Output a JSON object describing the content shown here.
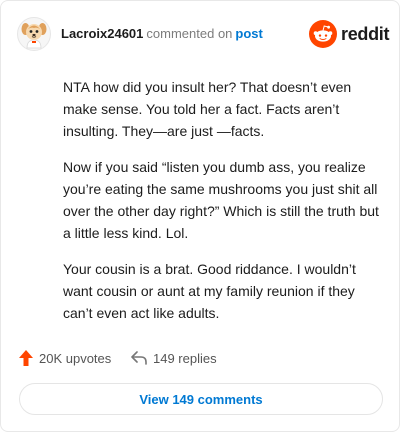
{
  "header": {
    "username": "Lacroix24601",
    "verb": "commented on",
    "target": "post",
    "brand": "reddit"
  },
  "comment": {
    "paragraphs": [
      "NTA how did you insult her? That doesn’t even make sense. You told her a fact. Facts aren’t insulting. They—are just —facts.",
      "Now if you said “listen you dumb ass, you realize you’re eating the same mushrooms you just shit all over the other day right?” Which is still the truth but a little less kind. Lol.",
      "Your cousin is a brat. Good riddance. I wouldn’t want cousin or aunt at my family reunion if they can’t even act like adults."
    ]
  },
  "actions": {
    "upvotes": "20K upvotes",
    "replies": "149 replies",
    "view_comments": "View 149 comments"
  },
  "icons": {
    "avatar": "cartoon-dog-avatar-icon",
    "brand": "reddit-alien-icon",
    "upvote": "upvote-arrow-icon",
    "reply": "reply-arrow-icon"
  },
  "colors": {
    "reddit_orange": "#ff4500",
    "link_blue": "#0079d3",
    "muted": "#7c7c7c"
  }
}
